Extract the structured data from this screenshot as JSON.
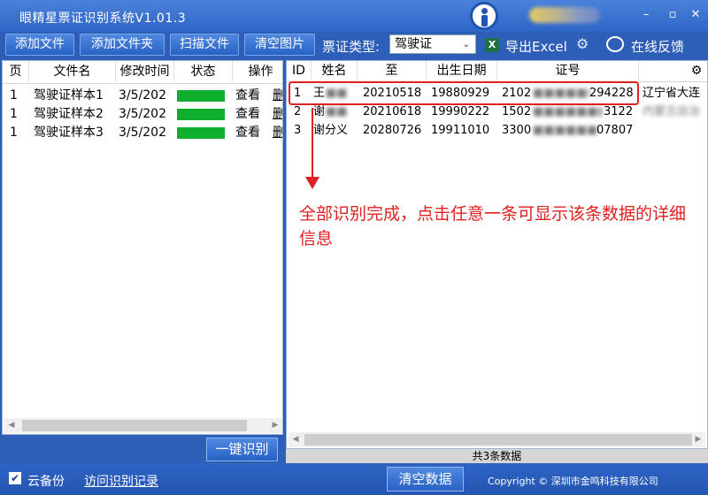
{
  "titlebar": {
    "title": "眼精星票证识别系统V1.01.3",
    "minimize": "–",
    "restore": "▫",
    "close": "✕"
  },
  "toolbar": {
    "add_file": "添加文件",
    "add_folder": "添加文件夹",
    "scan_file": "扫描文件",
    "clear_images": "清空图片",
    "ticket_type_label": "票证类型:",
    "ticket_type_value": "驾驶证",
    "export_excel": "导出Excel",
    "online_feedback": "在线反馈"
  },
  "left_table": {
    "headers": [
      "页",
      "文件名",
      "修改时间",
      "状态",
      "操作"
    ],
    "rows": [
      {
        "page": "1",
        "name": "驾驶证样本1",
        "time": "3/5/202",
        "view": "查看",
        "delete": "删"
      },
      {
        "page": "1",
        "name": "驾驶证样本2",
        "time": "3/5/202",
        "view": "查看",
        "delete": "删"
      },
      {
        "page": "1",
        "name": "驾驶证样本3",
        "time": "3/5/202",
        "view": "查看",
        "delete": "删"
      }
    ]
  },
  "recognize_button": "一键识别",
  "right_table": {
    "headers": [
      "ID",
      "姓名",
      "至",
      "出生日期",
      "证号"
    ],
    "rows": [
      {
        "id": "1",
        "name": "王",
        "to": "20210518",
        "birth": "19880929",
        "num_a": "2102",
        "num_b": "294228",
        "addr": "辽宁省大连"
      },
      {
        "id": "2",
        "name": "谢",
        "to": "20210618",
        "birth": "19990222",
        "num_a": "1502",
        "num_b": "3122",
        "addr": "内蒙古自治"
      },
      {
        "id": "3",
        "name": "谢分义",
        "to": "20280726",
        "birth": "19911010",
        "num_a": "3300",
        "num_b": "07807",
        "addr": ""
      }
    ]
  },
  "annotation": "全部识别完成，点击任意一条可显示该条数据的详细信息",
  "count_text": "共3条数据",
  "bottom": {
    "cloud_backup": "云备份",
    "visit_history": "访问识别记录",
    "clear_data": "清空数据",
    "copyright": "Copyright © 深圳市金鸣科技有限公司"
  },
  "colors": {
    "accent": "#2e5fb8",
    "status_green": "#0fae2f",
    "annotation_red": "#e02020"
  }
}
